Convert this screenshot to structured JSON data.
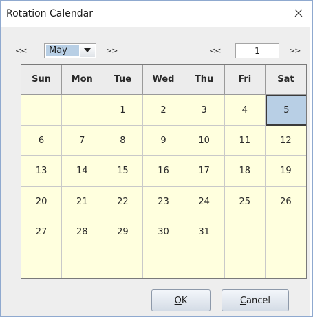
{
  "window": {
    "title": "Rotation Calendar",
    "close_icon": "close-icon"
  },
  "nav": {
    "prev_month": "<<",
    "month_value": "May",
    "next_month": ">>",
    "prev_year": "<<",
    "year_value": "1",
    "next_year": ">>"
  },
  "calendar": {
    "weekdays": [
      "Sun",
      "Mon",
      "Tue",
      "Wed",
      "Thu",
      "Fri",
      "Sat"
    ],
    "weeks": [
      [
        "",
        "",
        "1",
        "2",
        "3",
        "4",
        "5"
      ],
      [
        "6",
        "7",
        "8",
        "9",
        "10",
        "11",
        "12"
      ],
      [
        "13",
        "14",
        "15",
        "16",
        "17",
        "18",
        "19"
      ],
      [
        "20",
        "21",
        "22",
        "23",
        "24",
        "25",
        "26"
      ],
      [
        "27",
        "28",
        "29",
        "30",
        "31",
        "",
        ""
      ],
      [
        "",
        "",
        "",
        "",
        "",
        "",
        ""
      ]
    ],
    "selected_day": "5",
    "colors": {
      "cell_bg": "#ffffde",
      "selected_bg": "#b8cfe5",
      "header_bg": "#ececec"
    }
  },
  "buttons": {
    "ok_mnemonic": "O",
    "ok_rest": "K",
    "cancel_mnemonic": "C",
    "cancel_rest": "ancel"
  }
}
